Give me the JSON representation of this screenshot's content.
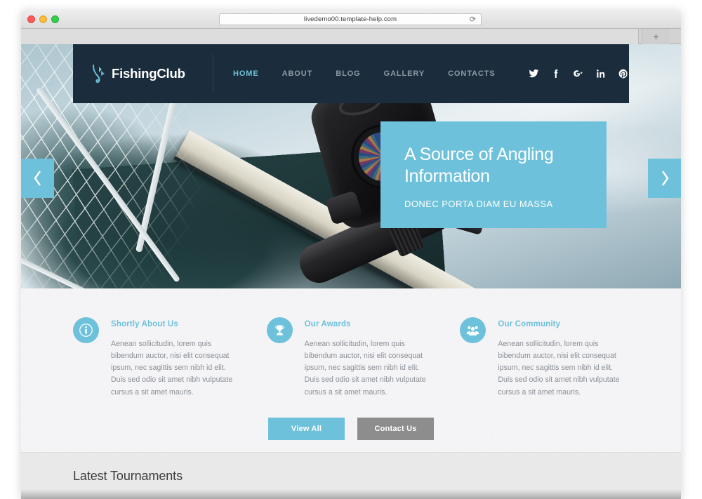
{
  "browser": {
    "url": "livedemo00.template-help.com",
    "reload_icon": "reload-icon",
    "new_tab_label": "+",
    "traffic_lights": [
      "close",
      "minimize",
      "maximize"
    ]
  },
  "colors": {
    "accent": "#6EC1DA",
    "header_bg": "#1B2D3D",
    "features_bg": "#F4F4F7",
    "secondary_button": "#8D8D8D",
    "nav_inactive": "#8E9AA4",
    "band_bg": "#E9E9EA"
  },
  "site_header": {
    "logo": {
      "icon": "fish-hook-icon",
      "text": "FishingClub"
    },
    "nav": [
      {
        "label": "HOME",
        "active": true
      },
      {
        "label": "ABOUT",
        "active": false
      },
      {
        "label": "BLOG",
        "active": false
      },
      {
        "label": "GALLERY",
        "active": false
      },
      {
        "label": "CONTACTS",
        "active": false
      }
    ],
    "social": [
      {
        "name": "twitter-icon"
      },
      {
        "name": "facebook-icon"
      },
      {
        "name": "google-plus-icon"
      },
      {
        "name": "linkedin-icon"
      },
      {
        "name": "pinterest-icon"
      }
    ]
  },
  "slider": {
    "caption": {
      "title": "A Source of Angling Information",
      "subtitle": "DONEC PORTA DIAM EU MASSA"
    },
    "prev_icon": "chevron-left-icon",
    "next_icon": "chevron-right-icon",
    "image_alt": "fishing net boat and reel over water"
  },
  "features": [
    {
      "icon": "info-icon",
      "title": "Shortly About Us",
      "text": "Aenean sollicitudin, lorem quis bibendum auctor, nisi elit consequat ipsum, nec sagittis sem nibh id elit. Duis sed odio sit amet nibh vulputate cursus a sit amet mauris."
    },
    {
      "icon": "trophy-icon",
      "title": "Our Awards",
      "text": "Aenean sollicitudin, lorem quis bibendum auctor, nisi elit consequat ipsum, nec sagittis sem nibh id elit. Duis sed odio sit amet nibh vulputate cursus a sit amet mauris."
    },
    {
      "icon": "people-group-icon",
      "title": "Our Community",
      "text": "Aenean sollicitudin, lorem quis bibendum auctor, nisi elit consequat ipsum, nec sagittis sem nibh id elit. Duis sed odio sit amet nibh vulputate cursus a sit amet mauris."
    }
  ],
  "buttons": {
    "view_all": "View All",
    "contact_us": "Contact Us"
  },
  "tournaments": {
    "title": "Latest Tournaments"
  }
}
